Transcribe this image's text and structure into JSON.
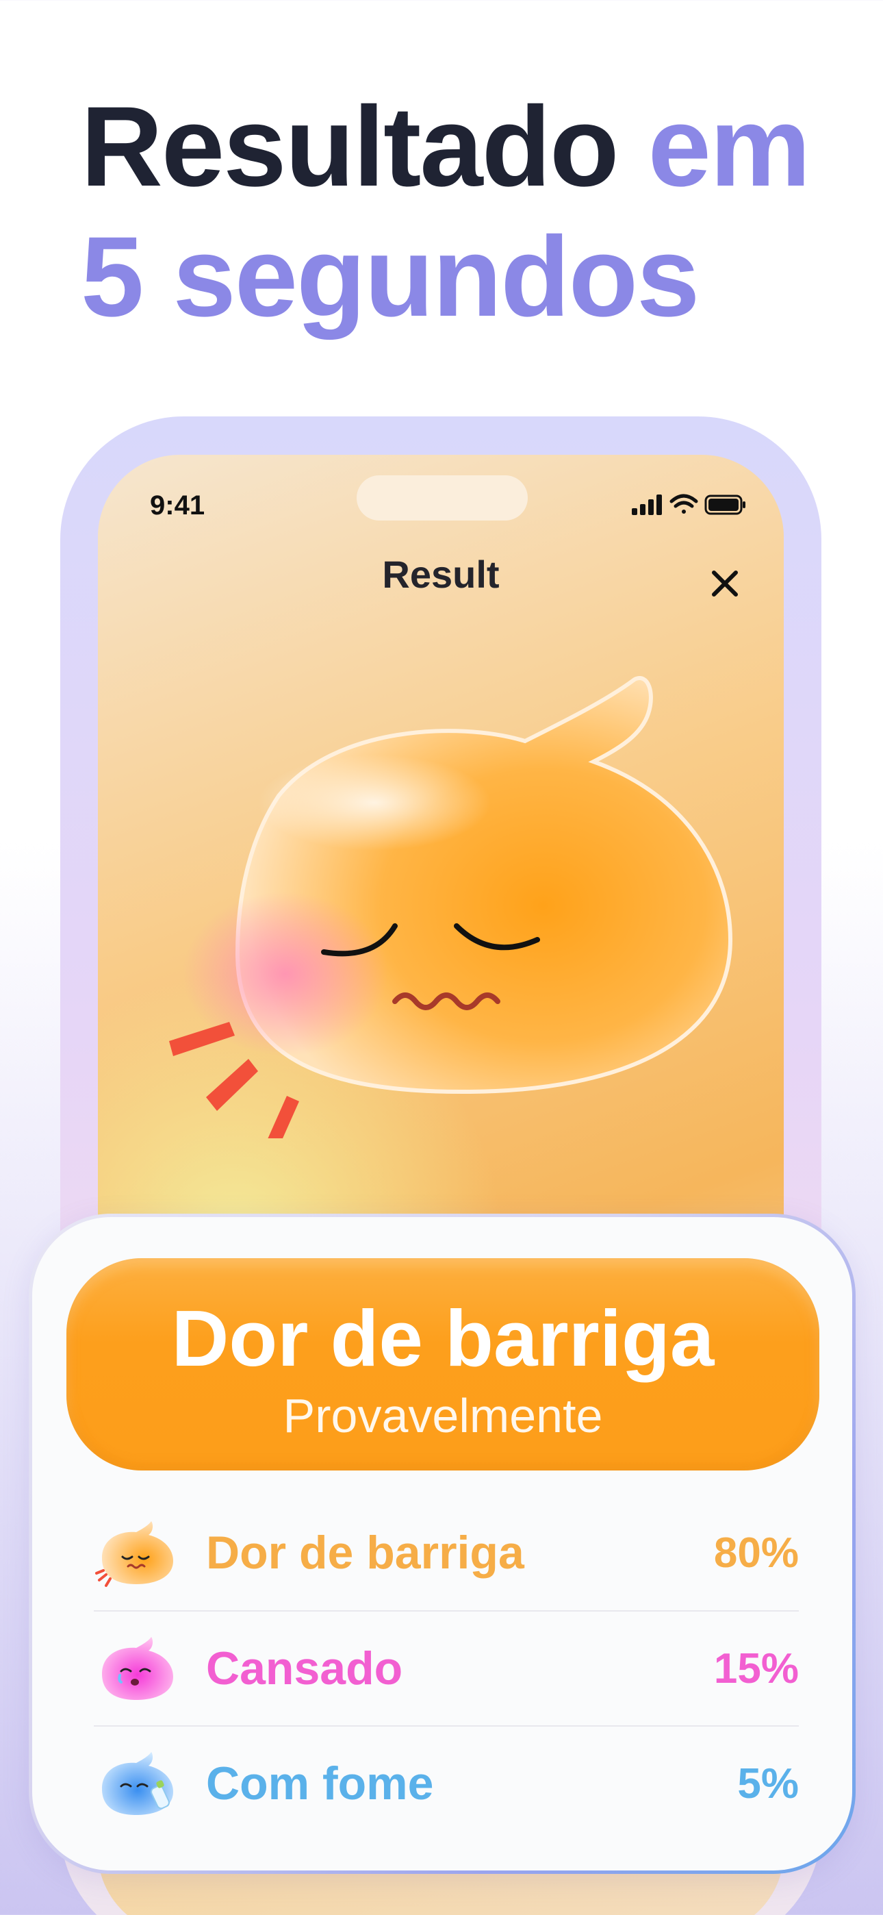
{
  "headline": {
    "line1_dark": "Resultado",
    "line1_accent": "em",
    "line2_accent": "5 segundos"
  },
  "colors": {
    "headline_dark": "#1f2333",
    "headline_accent": "#8b88e6",
    "banner": "#fd9f1c"
  },
  "status_bar": {
    "time": "9:41",
    "icons": [
      "signal-icon",
      "wifi-icon",
      "battery-icon"
    ]
  },
  "screen": {
    "title": "Result",
    "close_icon": "close-icon",
    "mascot": "sad-orange-blob-illustration"
  },
  "result": {
    "title": "Dor de barriga",
    "subtitle": "Provavelmente"
  },
  "predictions": [
    {
      "label": "Dor de barriga",
      "percent": "80%",
      "value": 80,
      "color": "#f6ad47",
      "icon": "orange-blob-icon"
    },
    {
      "label": "Cansado",
      "percent": "15%",
      "value": 15,
      "color": "#f25fd1",
      "icon": "pink-blob-icon"
    },
    {
      "label": "Com fome",
      "percent": "5%",
      "value": 5,
      "color": "#5ab1ea",
      "icon": "blue-blob-icon"
    }
  ]
}
